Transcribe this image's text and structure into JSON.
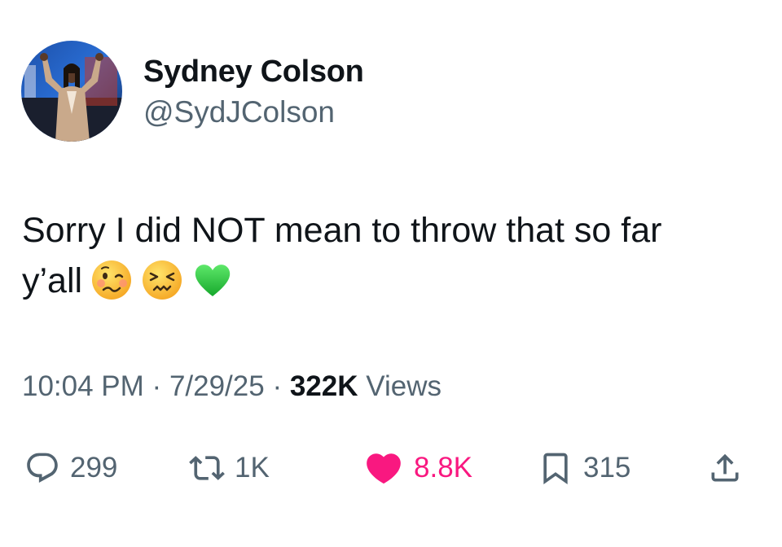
{
  "author": {
    "display_name": "Sydney Colson",
    "handle": "@SydJColson",
    "avatar_icon": "profile-photo"
  },
  "tweet": {
    "text": "Sorry I did NOT mean to throw that so far",
    "text_line2": "y’all",
    "emojis": [
      "woozy-face-icon",
      "confounded-face-icon",
      "green-heart-icon"
    ]
  },
  "meta": {
    "time": "10:04 PM",
    "separator": "·",
    "date": "7/29/25",
    "views_count": "322K",
    "views_label": "Views"
  },
  "actions": {
    "replies": "299",
    "reposts": "1K",
    "likes": "8.8K",
    "bookmarks": "315"
  },
  "colors": {
    "text_primary": "#0f1419",
    "text_secondary": "#536471",
    "like_pink": "#f91880",
    "green_heart": "#2ecc40"
  }
}
